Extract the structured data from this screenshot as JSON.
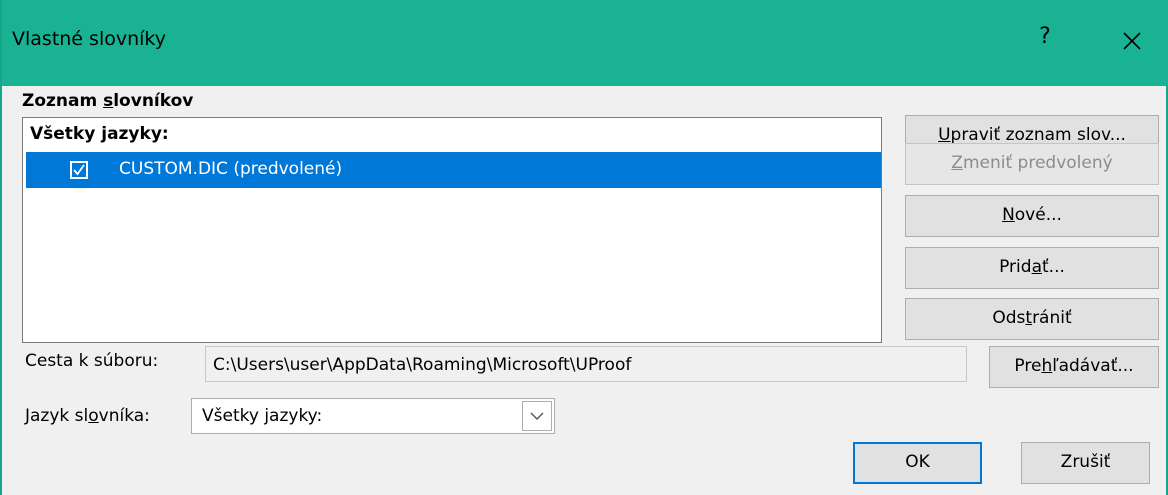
{
  "window": {
    "title": "Vlastné slovníky",
    "help_label": "?"
  },
  "list_section": {
    "label_pre": "Zoznam ",
    "label_key": "s",
    "label_post": "lovníkov",
    "group_header": "Všetky jazyky:",
    "items": [
      {
        "label": "CUSTOM.DIC (predvolené)",
        "checked": true,
        "selected": true
      }
    ]
  },
  "buttons": {
    "edit_pre": "",
    "edit_key": "U",
    "edit_post": "praviť zoznam slov...",
    "change_pre": "",
    "change_key": "Z",
    "change_post": "meniť predvolený",
    "new_pre": "",
    "new_key": "N",
    "new_post": "ové...",
    "add_pre": "Prid",
    "add_key": "a",
    "add_post": "ť...",
    "remove_pre": "Ods",
    "remove_key": "t",
    "remove_post": "rániť",
    "browse_pre": "Pre",
    "browse_key": "h",
    "browse_post": "ľadávať...",
    "ok": "OK",
    "cancel": "Zrušiť"
  },
  "file_path": {
    "label": "Cesta k súboru:",
    "value": "C:\\Users\\user\\AppData\\Roaming\\Microsoft\\UProof"
  },
  "language": {
    "label_pre": "Jazyk sl",
    "label_key": "o",
    "label_post": "vníka:",
    "selected": "Všetky jazyky:"
  },
  "colors": {
    "titlebar": "#19b394",
    "selection": "#0078d7",
    "default_button_border": "#0078d7"
  }
}
